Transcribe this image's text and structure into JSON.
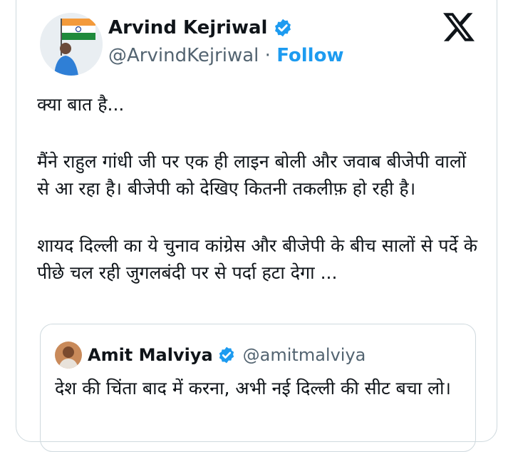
{
  "author": {
    "name": "Arvind Kejriwal",
    "handle": "@ArvindKejriwal",
    "separator": "·",
    "follow_label": "Follow",
    "verified_icon": "verified-badge-icon"
  },
  "brand": {
    "logo": "x-logo-icon"
  },
  "tweet": {
    "para1": "क्या बात है...",
    "para2": "मैंने राहुल गांधी जी पर एक ही लाइन बोली और जवाब बीजेपी वालों से आ रहा है। बीजेपी को देखिए कितनी तकलीफ़ हो रही है।",
    "para3": "शायद दिल्ली का ये चुनाव कांग्रेस और बीजेपी के बीच सालों से पर्दे के पीछे चल रही जुगलबंदी पर से पर्दा हटा देगा ..."
  },
  "quoted": {
    "name": "Amit Malviya",
    "handle": "@amitmalviya",
    "text": "देश की चिंता बाद में करना, अभी नई दिल्ली की सीट बचा लो।"
  },
  "colors": {
    "link": "#1d9bf0",
    "verified": "#1d9bf0",
    "secondary_text": "#536471",
    "border": "#cfd9de"
  }
}
